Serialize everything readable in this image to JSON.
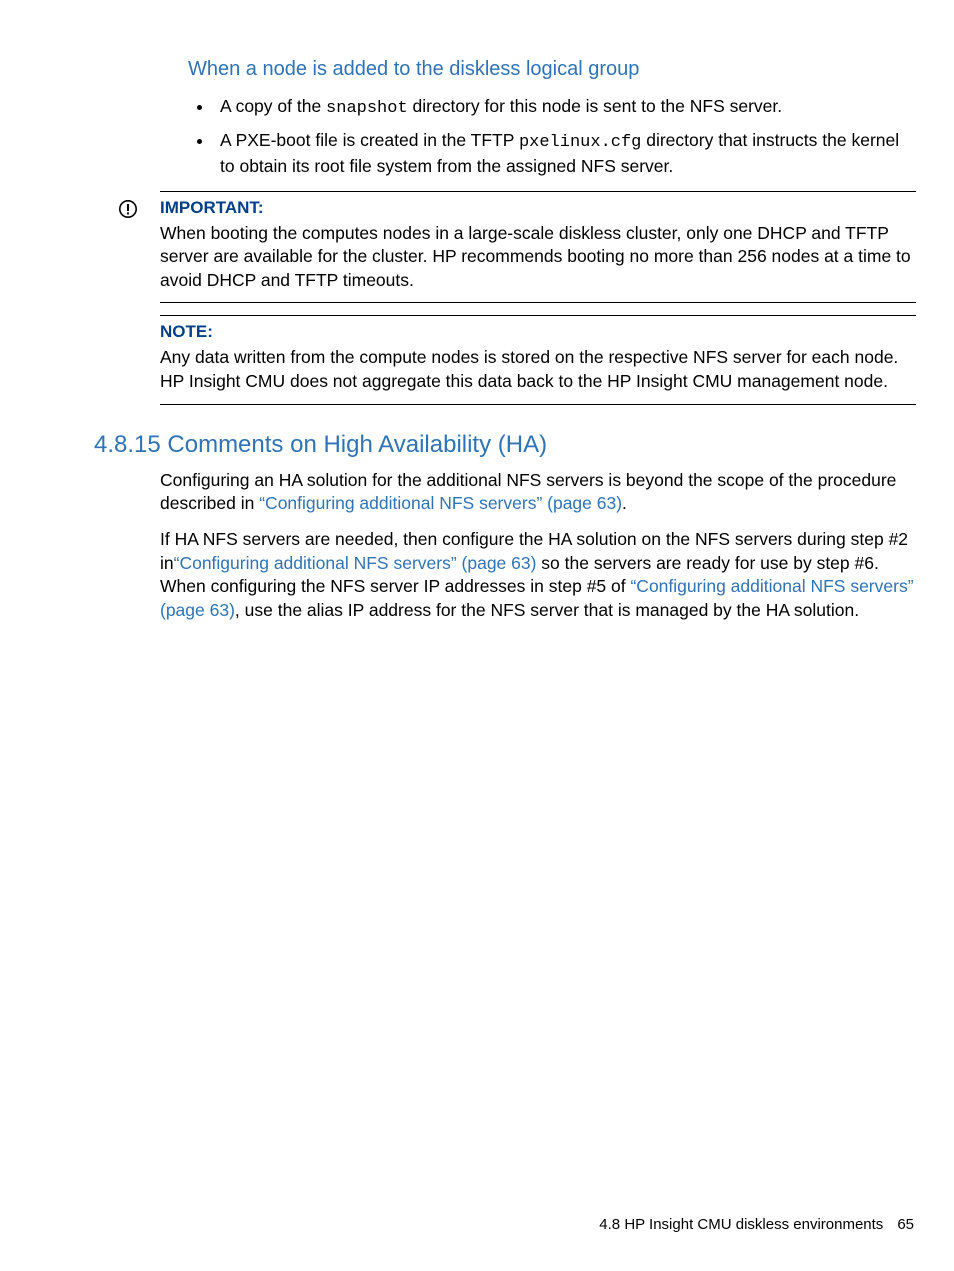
{
  "subheading": "When a node is added to the diskless logical group",
  "bullets": {
    "b1_a": "A copy of the ",
    "b1_code": "snapshot",
    "b1_b": " directory for this node is sent to the NFS server.",
    "b2_a": "A PXE-boot file is created in the TFTP ",
    "b2_code": "pxelinux.cfg",
    "b2_b": " directory that instructs the kernel to obtain its root file system from the assigned NFS server."
  },
  "important": {
    "label": "IMPORTANT:",
    "body": "When booting the computes nodes in a large-scale diskless cluster, only one DHCP and TFTP server are available for the cluster. HP recommends booting no more than 256 nodes at a time to avoid DHCP and TFTP timeouts."
  },
  "note": {
    "label": "NOTE:",
    "body": "Any data written from the compute nodes is stored on the respective NFS server for each node. HP Insight CMU does not aggregate this data back to the HP Insight CMU management node."
  },
  "section_heading": "4.8.15 Comments on High Availability (HA)",
  "p1_a": "Configuring an HA solution for the additional NFS servers is beyond the scope of the procedure described in ",
  "p1_link": "“Configuring additional NFS servers” (page 63)",
  "p1_b": ".",
  "p2_a": "If HA NFS servers are needed, then configure the HA solution on the NFS servers during step #2 in",
  "p2_link1": "“Configuring additional NFS servers” (page 63)",
  "p2_b": " so the servers are ready for use by step #6. When configuring the NFS server IP addresses in step #5 of ",
  "p2_link2": "“Configuring additional NFS servers” (page 63)",
  "p2_c": ", use the alias IP address for the NFS server that is managed by the HA solution.",
  "footer_section": "4.8 HP Insight CMU diskless environments",
  "footer_page": "65"
}
